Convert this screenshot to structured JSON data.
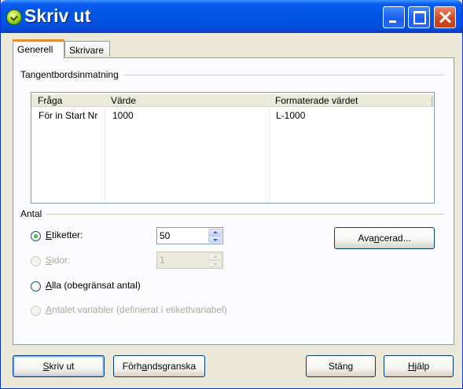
{
  "window": {
    "title": "Skriv ut",
    "controls": {
      "minimize": "minimize-icon",
      "maximize": "maximize-icon",
      "close": "close-icon"
    }
  },
  "tabs": [
    {
      "label": "Generell",
      "active": true
    },
    {
      "label": "Skrivare",
      "active": false
    }
  ],
  "keyboard_input": {
    "group_label": "Tangentbordsinmatning",
    "columns": [
      "Fråga",
      "Värde",
      "Formaterade värdet"
    ],
    "rows": [
      {
        "question": "För in Start Nr",
        "value": "1000",
        "formatted": "L-1000"
      }
    ]
  },
  "quantity": {
    "group_label": "Antal",
    "options": [
      {
        "pre": "",
        "accel": "E",
        "post": "tiketter:",
        "checked": true,
        "enabled": true,
        "spin_value": "50"
      },
      {
        "pre": "",
        "accel": "S",
        "post": "idor:",
        "checked": false,
        "enabled": false,
        "spin_value": "1"
      },
      {
        "pre": "",
        "accel": "A",
        "post": "lla (obegränsat antal)",
        "checked": false,
        "enabled": true
      },
      {
        "pre": "",
        "accel": "A",
        "post": "ntalet variabler (definierat i etikettvariabel)",
        "checked": false,
        "enabled": false
      }
    ],
    "advanced_button": {
      "pre": "Ava",
      "accel": "n",
      "post": "cerad..."
    }
  },
  "footer": {
    "print": {
      "pre": "",
      "accel": "S",
      "post": "kriv ut"
    },
    "preview": {
      "pre": "Förh",
      "accel": "a",
      "post": "ndsgranska"
    },
    "close": "Stäng",
    "help": {
      "pre": "",
      "accel": "H",
      "post": "jälp"
    }
  },
  "colors": {
    "title_bar": "#0055e5",
    "dialog_bg": "#ece9d8",
    "panel_bg": "#fcfcfe",
    "active_tab_accent": "#e68b2c",
    "radio_checked": "#21a121"
  }
}
